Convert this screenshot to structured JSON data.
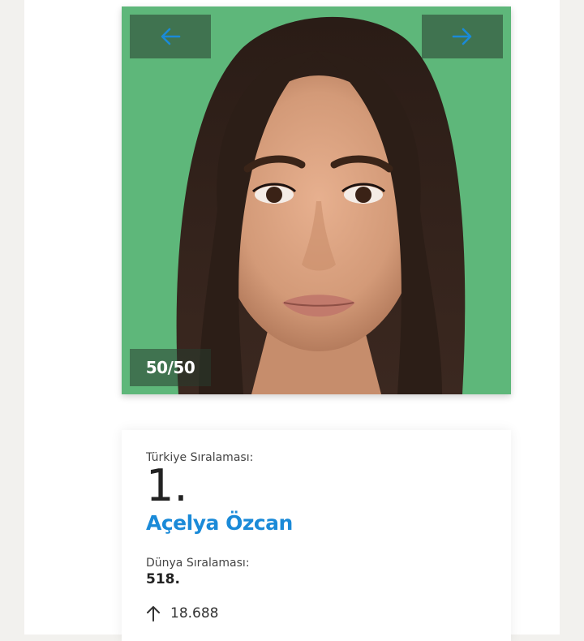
{
  "gallery": {
    "counter": "50/50",
    "bg_color": "#5eb77a",
    "prev_icon": "arrow-left-icon",
    "next_icon": "arrow-right-icon",
    "accent": "#1a8ad8"
  },
  "card": {
    "turkey_rank_label": "Türkiye Sıralaması:",
    "turkey_rank": "1.",
    "name": "Açelya Özcan",
    "world_rank_label": "Dünya Sıralaması:",
    "world_rank": "518.",
    "votes_icon": "arrow-up-icon",
    "votes": "18.688"
  }
}
